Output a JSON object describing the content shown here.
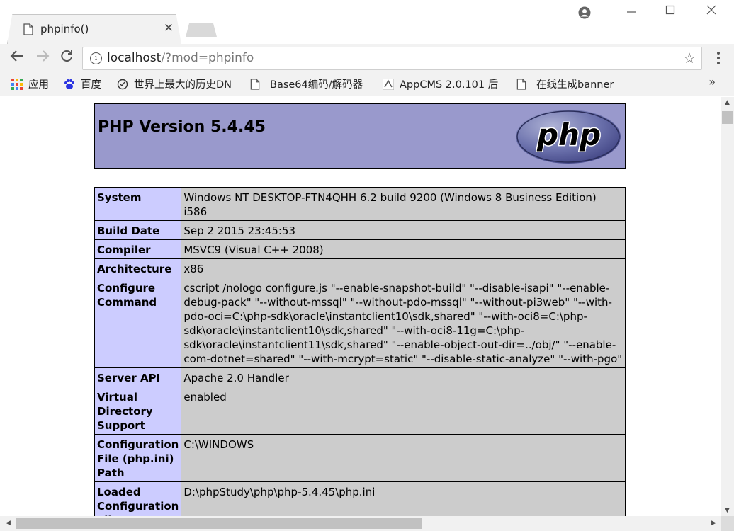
{
  "tab": {
    "title": "phpinfo()"
  },
  "address_bar": {
    "host": "localhost",
    "path": "/?mod=phpinfo"
  },
  "bookmarks": [
    {
      "label": "应用",
      "icon": "apps-grid-icon"
    },
    {
      "label": "百度",
      "icon": "baidu-paw-icon"
    },
    {
      "label": "世界上最大的历史DN",
      "icon": "history-icon"
    },
    {
      "label": "Base64编码/解码器",
      "icon": "page-icon"
    },
    {
      "label": "AppCMS 2.0.101 后",
      "icon": "appcms-icon"
    },
    {
      "label": "在线生成banner",
      "icon": "page-icon"
    }
  ],
  "php": {
    "version_title": "PHP Version 5.4.45",
    "logo_text": "php"
  },
  "info_rows": [
    {
      "key": "System",
      "value": "Windows NT DESKTOP-FTN4QHH 6.2 build 9200 (Windows 8 Business Edition) i586"
    },
    {
      "key": "Build Date",
      "value": "Sep 2 2015 23:45:53"
    },
    {
      "key": "Compiler",
      "value": "MSVC9 (Visual C++ 2008)"
    },
    {
      "key": "Architecture",
      "value": "x86"
    },
    {
      "key": "Configure Command",
      "value": "cscript /nologo configure.js \"--enable-snapshot-build\" \"--disable-isapi\" \"--enable-debug-pack\" \"--without-mssql\" \"--without-pdo-mssql\" \"--without-pi3web\" \"--with-pdo-oci=C:\\php-sdk\\oracle\\instantclient10\\sdk,shared\" \"--with-oci8=C:\\php-sdk\\oracle\\instantclient10\\sdk,shared\" \"--with-oci8-11g=C:\\php-sdk\\oracle\\instantclient11\\sdk,shared\" \"--enable-object-out-dir=../obj/\" \"--enable-com-dotnet=shared\" \"--with-mcrypt=static\" \"--disable-static-analyze\" \"--with-pgo\""
    },
    {
      "key": "Server API",
      "value": "Apache 2.0 Handler"
    },
    {
      "key": "Virtual Directory Support",
      "value": "enabled"
    },
    {
      "key": "Configuration File (php.ini) Path",
      "value": "C:\\WINDOWS"
    },
    {
      "key": "Loaded Configuration File",
      "value": "D:\\phpStudy\\php\\php-5.4.45\\php.ini"
    }
  ]
}
